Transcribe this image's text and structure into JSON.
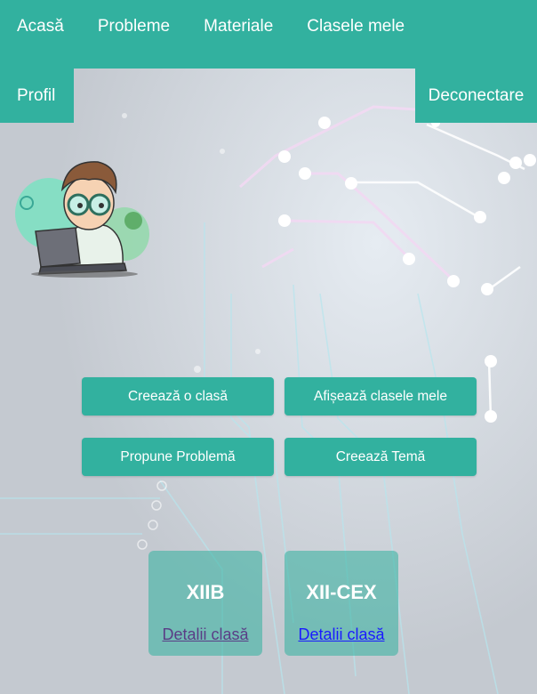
{
  "nav": {
    "items": [
      "Acasă",
      "Probleme",
      "Materiale",
      "Clasele mele"
    ],
    "profile": "Profil",
    "logout": "Deconectare"
  },
  "actions": {
    "create_class": "Creează o clasă",
    "show_classes": "Afișează clasele mele",
    "propose_problem": "Propune Problemă",
    "create_homework": "Creează Temă"
  },
  "classes": [
    {
      "name": "XIIB",
      "link": "Detalii clasă"
    },
    {
      "name": "XII-CEX",
      "link": "Detalii clasă"
    }
  ],
  "colors": {
    "accent": "#32b19f",
    "visited_link": "#5a3d86",
    "link": "#1a1aff"
  }
}
